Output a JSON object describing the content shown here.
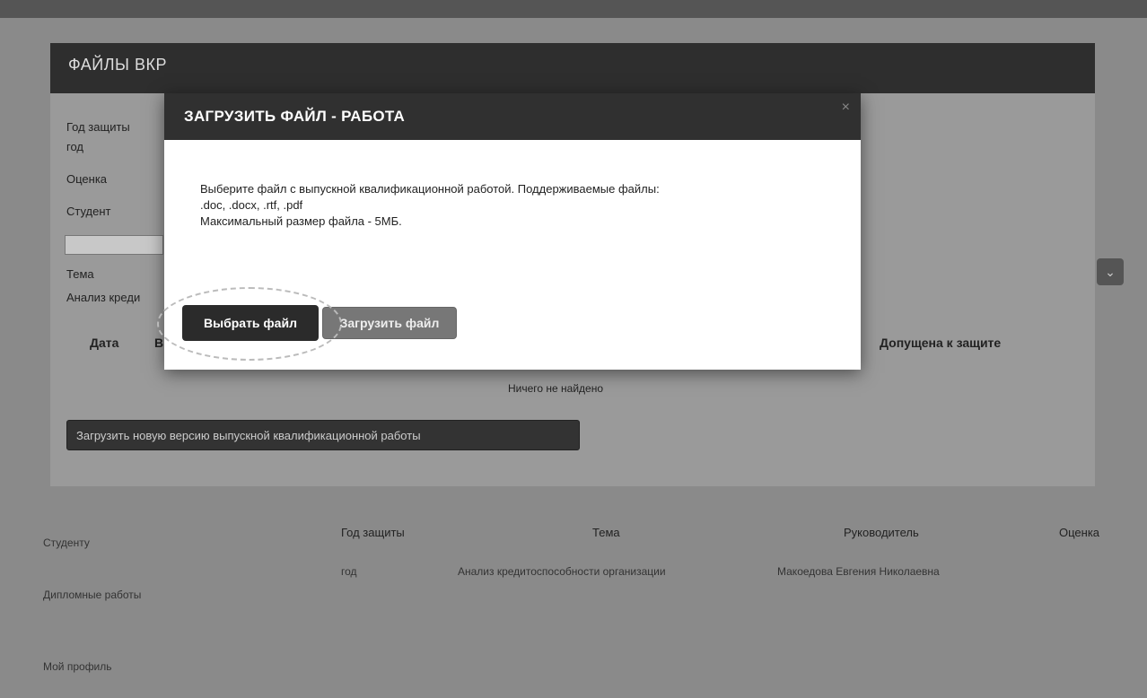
{
  "background": {
    "table_headers": [
      "Год защиты",
      "Тема",
      "Руководитель",
      "Оценка"
    ],
    "table_row": {
      "year": "год",
      "topic": "Анализ кредитоспособности организации",
      "supervisor": "Макоедова Евгения Николаевна"
    },
    "sidebar_items": [
      "Студенту",
      "Дипломные работы",
      "Мой профиль"
    ]
  },
  "files_panel": {
    "title": "ФАЙЛЫ ВКР",
    "labels": {
      "year_label": "Год защиты",
      "year_value": "год",
      "grade_label": "Оценка",
      "student_label": "Студент",
      "topic_label": "Тема",
      "topic_value": "Анализ креди"
    },
    "table_headers": {
      "date": "Дата",
      "col2": "В",
      "admitted": "Допущена к защите"
    },
    "empty_text": "Ничего не найдено",
    "upload_new_label": "Загрузить новую версию выпускной квалификационной работы"
  },
  "dialog": {
    "title": "ЗАГРУЗИТЬ ФАЙЛ - РАБОТА",
    "close_symbol": "×",
    "body_line1": "Выберите файл с выпускной квалификационной работой. Поддерживаемые файлы:",
    "body_line2": ".doc, .docx, .rtf, .pdf",
    "body_line3": "Максимальный размер файла - 5МБ.",
    "choose_button": "Выбрать файл",
    "upload_button": "Загрузить файл"
  },
  "icons": {
    "chevron": "chevron-down-icon",
    "close": "close-icon"
  },
  "colors": {
    "header_bg": "#303030",
    "primary_button": "#2b2b2b",
    "secondary_button": "#777777"
  }
}
